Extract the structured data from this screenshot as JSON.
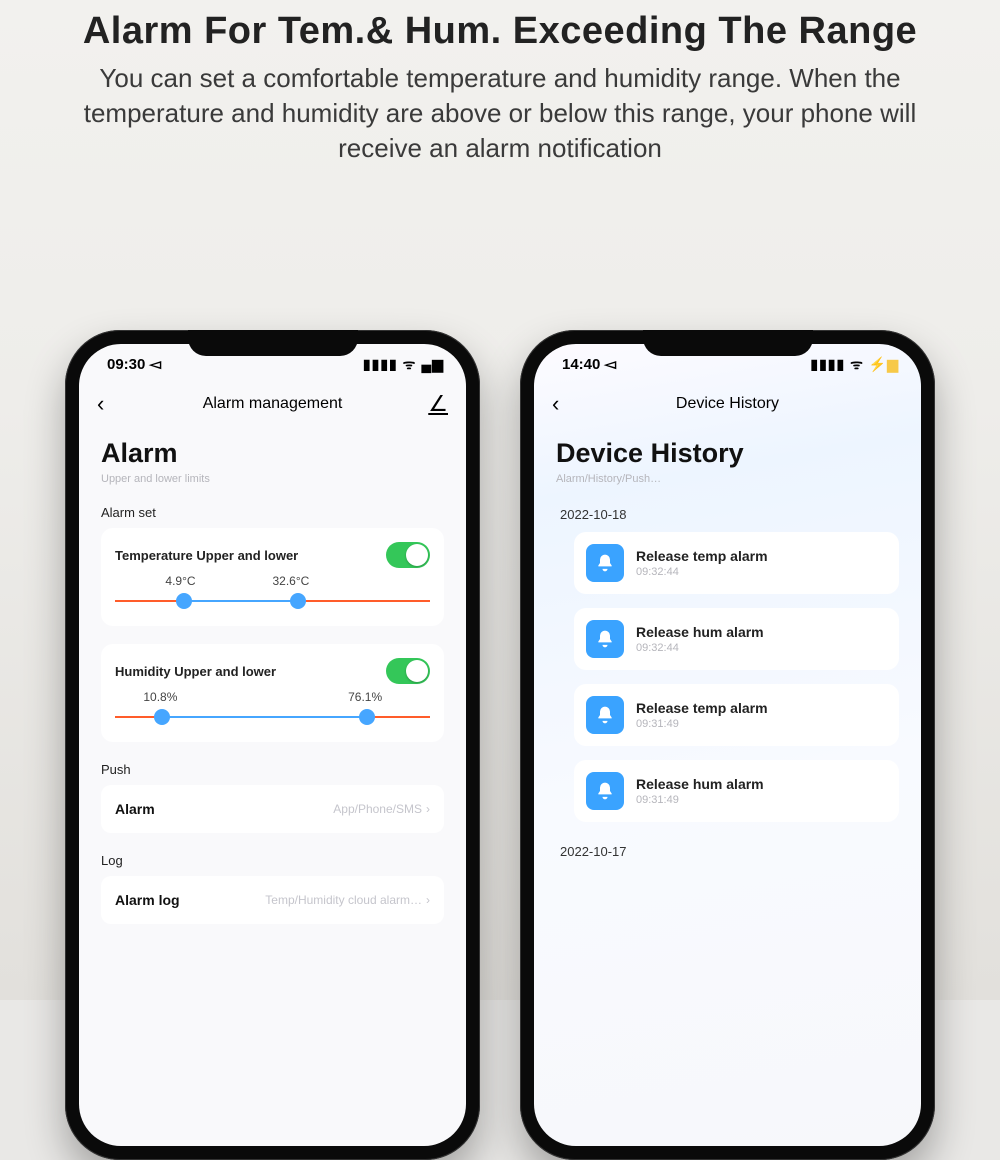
{
  "header": {
    "title": "Alarm For Tem.& Hum. Exceeding The Range",
    "subtitle": "You can set a comfortable temperature and humidity range. When the temperature and humidity are above or below this range, your phone will receive an alarm notification"
  },
  "left": {
    "status_time": "09:30",
    "nav_title": "Alarm management",
    "heading": "Alarm",
    "subheading": "Upper and lower limits",
    "section_alarm_set": "Alarm set",
    "temp": {
      "label": "Temperature Upper and lower",
      "low": "4.9°C",
      "high": "32.6°C",
      "low_pct": 22,
      "high_pct": 58
    },
    "hum": {
      "label": "Humidity Upper and lower",
      "low": "10.8%",
      "high": "76.1%",
      "low_pct": 15,
      "high_pct": 80
    },
    "section_push": "Push",
    "push_row": {
      "label": "Alarm",
      "hint": "App/Phone/SMS"
    },
    "section_log": "Log",
    "log_row": {
      "label": "Alarm log",
      "hint": "Temp/Humidity cloud alarm…"
    }
  },
  "right": {
    "status_time": "14:40",
    "nav_title": "Device History",
    "heading": "Device History",
    "subheading": "Alarm/History/Push…",
    "groups": [
      {
        "date": "2022-10-18",
        "items": [
          {
            "title": "Release temp alarm",
            "time": "09:32:44"
          },
          {
            "title": "Release hum alarm",
            "time": "09:32:44"
          },
          {
            "title": "Release temp alarm",
            "time": "09:31:49"
          },
          {
            "title": "Release hum alarm",
            "time": "09:31:49"
          }
        ]
      },
      {
        "date": "2022-10-17",
        "items": []
      }
    ]
  }
}
